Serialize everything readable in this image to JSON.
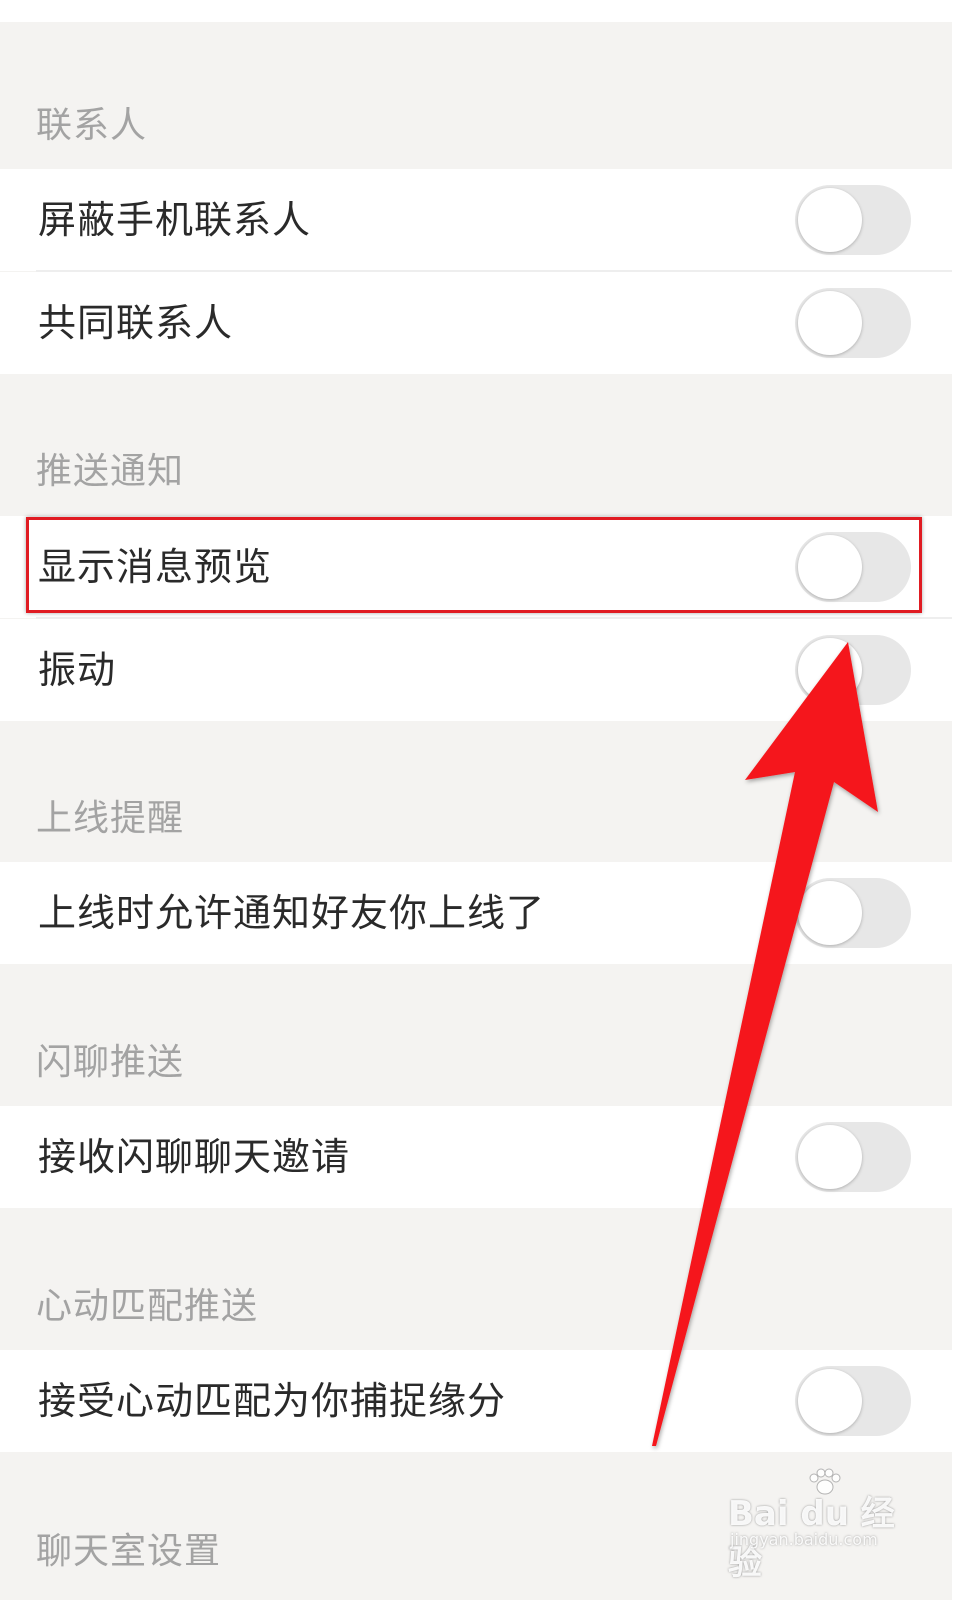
{
  "sections": [
    {
      "title": "联系人",
      "items": [
        {
          "label": "屏蔽手机联系人",
          "enabled": false
        },
        {
          "label": "共同联系人",
          "enabled": false
        }
      ]
    },
    {
      "title": "推送通知",
      "items": [
        {
          "label": "显示消息预览",
          "enabled": false
        },
        {
          "label": "振动",
          "enabled": false
        }
      ]
    },
    {
      "title": "上线提醒",
      "items": [
        {
          "label": "上线时允许通知好友你上线了",
          "enabled": false
        }
      ]
    },
    {
      "title": "闪聊推送",
      "items": [
        {
          "label": "接收闪聊聊天邀请",
          "enabled": false
        }
      ]
    },
    {
      "title": "心动匹配推送",
      "items": [
        {
          "label": "接受心动匹配为你捕捉缘分",
          "enabled": false
        }
      ]
    },
    {
      "title": "聊天室设置",
      "items": []
    }
  ],
  "annotation": {
    "highlight_color": "#e01b22",
    "arrow_color": "#f5141a"
  },
  "watermark": {
    "brand": "Bai du 经验",
    "url": "jingyan.baidu.com"
  },
  "colors": {
    "background": "#f4f3f1",
    "row": "#ffffff",
    "section_text": "#a3a3a3",
    "label_text": "#2a2a2a",
    "toggle_off": "#e7e7e7"
  }
}
